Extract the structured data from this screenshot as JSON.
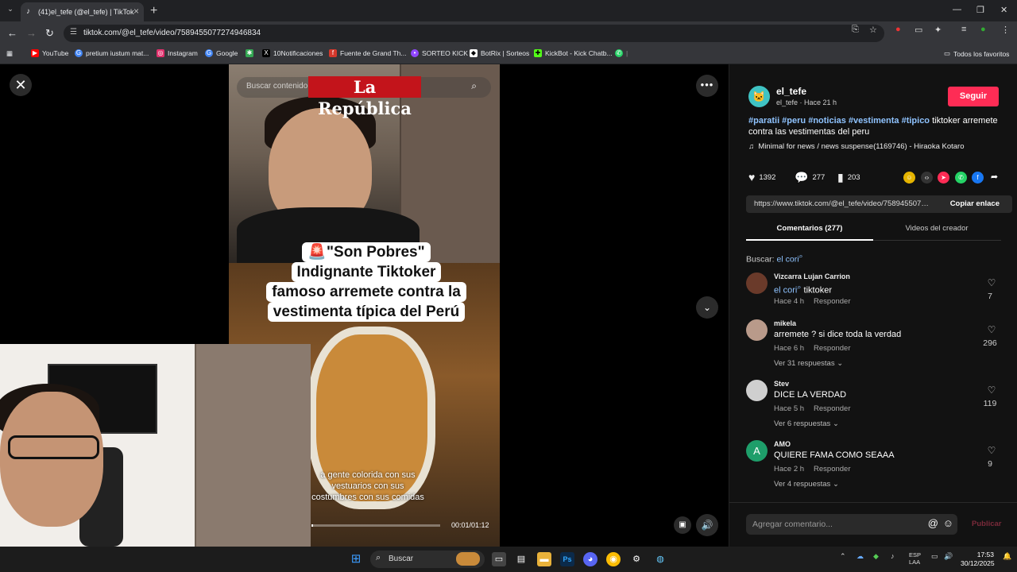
{
  "browser": {
    "tab_title": "(41)el_tefe (@el_tefe) | TikTok",
    "url": "tiktok.com/@el_tefe/video/7589455077274946834",
    "bookmarks": [
      {
        "label": "YouTube",
        "color": "#ff0000"
      },
      {
        "label": "pretium iustum mat...",
        "color": "#4285f4"
      },
      {
        "label": "Instagram",
        "color": "#e1306c"
      },
      {
        "label": "Google",
        "color": "#4285f4"
      },
      {
        "label": "",
        "color": "#34a853"
      },
      {
        "label": "10Notificaciones",
        "color": "#000000"
      },
      {
        "label": "Fuente de Grand Th...",
        "color": "#d4382c"
      },
      {
        "label": "SORTEO KICK",
        "color": "#9147ff"
      },
      {
        "label": "BotRix | Sorteos",
        "color": "#ffffff"
      },
      {
        "label": "KickBot - Kick Chatb...",
        "color": "#53fc18"
      },
      {
        "label": "",
        "color": "#25d366"
      }
    ],
    "all_bookmarks": "Todos los favoritos"
  },
  "video": {
    "search_placeholder": "Buscar contenido relacionado",
    "logo_text": "La República",
    "caption_lines": [
      "🚨\"Son Pobres\"",
      "Indignante Tiktoker",
      "famoso arremete contra la",
      "vestimenta típica del Perú"
    ],
    "subtitle": "a gente colorida con sus vestuarios con sus costumbres con sus comidas",
    "timecode": "00:01/01:12",
    "progress": 0.01
  },
  "sidebar": {
    "username": "el_tefe",
    "subline": "el_tefe · Hace 21 h",
    "follow_label": "Seguir",
    "hashtags": "#paratii #peru #noticias #vestimenta #tipico",
    "description": " tiktoker arremete contra las vestimentas del peru",
    "music": "Minimal for news / news suspense(1169746) - Hiraoka Kotaro",
    "likes": "1392",
    "comments_count": "277",
    "saves": "203",
    "share_link": "https://www.tiktok.com/@el_tefe/video/7589455077274946834",
    "copy_label": "Copiar enlace",
    "tab_comments": "Comentarios (277)",
    "tab_creator": "Videos del creador",
    "search_label": "Buscar:",
    "search_keyword": "el cori",
    "comments": [
      {
        "user": "Vizcarra Lujan Carrion",
        "text_kw": "el cori",
        "text": " tiktoker",
        "time": "Hace 4 h",
        "reply": "Responder",
        "likes": "7",
        "more": "",
        "avatar_color": "#6a3a2a",
        "avatar_letter": ""
      },
      {
        "user": "mikela",
        "text_kw": "",
        "text": "arremete ? si dice toda la verdad",
        "time": "Hace 6 h",
        "reply": "Responder",
        "likes": "296",
        "more": "Ver 31 respuestas",
        "avatar_color": "#b99a8a",
        "avatar_letter": ""
      },
      {
        "user": "Stev",
        "text_kw": "",
        "text": "DICE LA VERDAD",
        "time": "Hace 5 h",
        "reply": "Responder",
        "likes": "119",
        "more": "Ver 6 respuestas",
        "avatar_color": "#cfcfcf",
        "avatar_letter": ""
      },
      {
        "user": "AMO",
        "text_kw": "",
        "text": "QUIERE FAMA COMO SEAAA",
        "time": "Hace 2 h",
        "reply": "Responder",
        "likes": "9",
        "more": "Ver 4 respuestas",
        "avatar_color": "#1e9e6a",
        "avatar_letter": "A"
      }
    ],
    "comment_placeholder": "Agregar comentario...",
    "post_label": "Publicar"
  },
  "taskbar": {
    "search_placeholder": "Buscar",
    "lang_1": "ESP",
    "lang_2": "LAA",
    "time": "17:53",
    "date": "30/12/2025"
  }
}
